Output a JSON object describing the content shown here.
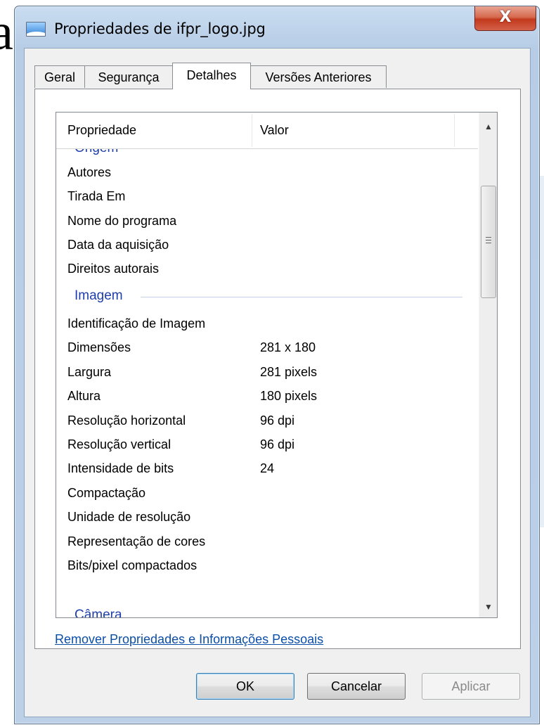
{
  "behind_text": "a",
  "window": {
    "title": "Propriedades de ifpr_logo.jpg",
    "close_glyph": "X",
    "icon": "image-file-icon"
  },
  "tabs": [
    {
      "label": "Geral",
      "active": false
    },
    {
      "label": "Segurança",
      "active": false
    },
    {
      "label": "Detalhes",
      "active": true
    },
    {
      "label": "Versões Anteriores",
      "active": false
    }
  ],
  "listview": {
    "columns": [
      "Propriedade",
      "Valor"
    ],
    "group_top": "Origem",
    "group_image": "Imagem",
    "group_bottom": "Câmera",
    "origin_rows": [
      {
        "name": "Autores",
        "value": ""
      },
      {
        "name": "Tirada Em",
        "value": ""
      },
      {
        "name": "Nome do programa",
        "value": ""
      },
      {
        "name": "Data da aquisição",
        "value": ""
      },
      {
        "name": "Direitos autorais",
        "value": ""
      }
    ],
    "image_rows": [
      {
        "name": "Identificação de Imagem",
        "value": ""
      },
      {
        "name": "Dimensões",
        "value": "281 x 180"
      },
      {
        "name": "Largura",
        "value": "281 pixels"
      },
      {
        "name": "Altura",
        "value": "180 pixels"
      },
      {
        "name": "Resolução horizontal",
        "value": "96 dpi"
      },
      {
        "name": "Resolução vertical",
        "value": "96 dpi"
      },
      {
        "name": "Intensidade de bits",
        "value": "24"
      },
      {
        "name": "Compactação",
        "value": ""
      },
      {
        "name": "Unidade de resolução",
        "value": ""
      },
      {
        "name": "Representação de cores",
        "value": ""
      },
      {
        "name": "Bits/pixel compactados",
        "value": ""
      }
    ],
    "scroll_up_glyph": "▲",
    "scroll_down_glyph": "▼"
  },
  "remove_link": "Remover Propriedades e Informações Pessoais",
  "buttons": {
    "ok": "OK",
    "cancel": "Cancelar",
    "apply": "Aplicar"
  }
}
